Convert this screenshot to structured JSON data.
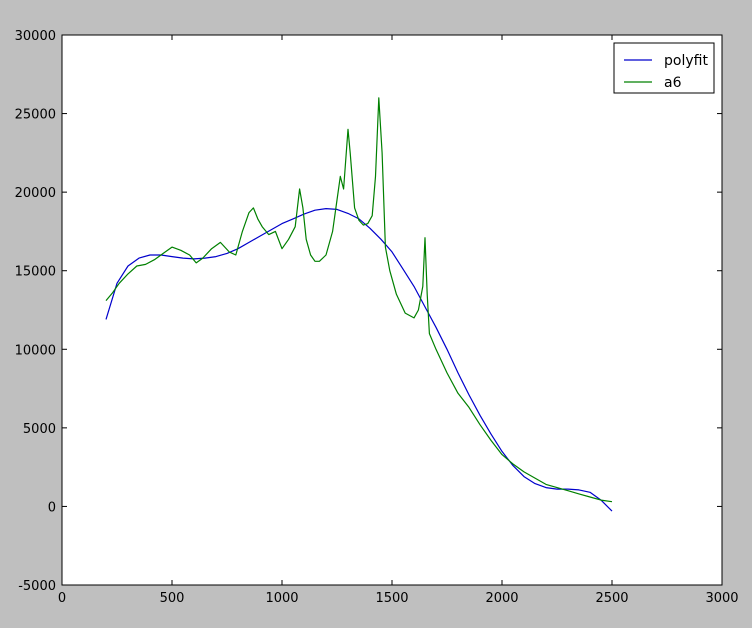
{
  "chart_data": {
    "type": "line",
    "title": "",
    "xlabel": "",
    "ylabel": "",
    "xlim": [
      0,
      3000
    ],
    "ylim": [
      -5000,
      30000
    ],
    "xticks": [
      0,
      500,
      1000,
      1500,
      2000,
      2500,
      3000
    ],
    "yticks": [
      -5000,
      0,
      5000,
      10000,
      15000,
      20000,
      25000,
      30000
    ],
    "grid": false,
    "legend_position": "top-right",
    "series": [
      {
        "name": "polyfit",
        "color": "#0000cc",
        "x": [
          200,
          250,
          300,
          350,
          400,
          450,
          500,
          550,
          600,
          650,
          700,
          750,
          800,
          850,
          900,
          950,
          1000,
          1050,
          1100,
          1150,
          1200,
          1250,
          1300,
          1350,
          1400,
          1450,
          1500,
          1550,
          1600,
          1650,
          1700,
          1750,
          1800,
          1850,
          1900,
          1950,
          2000,
          2050,
          2100,
          2150,
          2200,
          2250,
          2300,
          2350,
          2400,
          2450,
          2500
        ],
        "y": [
          11900,
          14200,
          15300,
          15800,
          16000,
          16000,
          15900,
          15800,
          15750,
          15800,
          15900,
          16100,
          16400,
          16800,
          17200,
          17600,
          18000,
          18300,
          18600,
          18850,
          18950,
          18900,
          18650,
          18300,
          17700,
          17000,
          16200,
          15100,
          14000,
          12700,
          11400,
          10000,
          8500,
          7100,
          5800,
          4600,
          3500,
          2600,
          1900,
          1450,
          1200,
          1100,
          1100,
          1050,
          900,
          400,
          -300
        ]
      },
      {
        "name": "a6",
        "color": "#008000",
        "x": [
          200,
          230,
          260,
          300,
          340,
          380,
          420,
          460,
          500,
          540,
          580,
          610,
          640,
          680,
          720,
          760,
          790,
          820,
          850,
          870,
          890,
          910,
          940,
          970,
          1000,
          1030,
          1060,
          1080,
          1095,
          1110,
          1130,
          1150,
          1170,
          1200,
          1230,
          1250,
          1265,
          1280,
          1300,
          1310,
          1330,
          1350,
          1370,
          1390,
          1410,
          1425,
          1440,
          1455,
          1470,
          1490,
          1520,
          1560,
          1600,
          1620,
          1640,
          1650,
          1660,
          1670,
          1700,
          1750,
          1800,
          1850,
          1900,
          1950,
          2000,
          2050,
          2100,
          2150,
          2200,
          2250,
          2300,
          2350,
          2400,
          2450,
          2500
        ],
        "y": [
          13100,
          13600,
          14200,
          14800,
          15300,
          15400,
          15700,
          16100,
          16500,
          16300,
          16000,
          15500,
          15800,
          16400,
          16800,
          16200,
          16000,
          17500,
          18700,
          19000,
          18300,
          17800,
          17300,
          17500,
          16400,
          17000,
          17800,
          20200,
          19000,
          17000,
          16000,
          15600,
          15600,
          16000,
          17500,
          19500,
          21000,
          20200,
          24000,
          22500,
          19000,
          18200,
          17900,
          18000,
          18500,
          21000,
          26000,
          22500,
          16500,
          15000,
          13500,
          12300,
          12000,
          12500,
          14000,
          17100,
          13500,
          11000,
          10000,
          8500,
          7200,
          6300,
          5200,
          4200,
          3300,
          2700,
          2200,
          1800,
          1400,
          1200,
          1000,
          800,
          600,
          400,
          300
        ]
      }
    ]
  }
}
